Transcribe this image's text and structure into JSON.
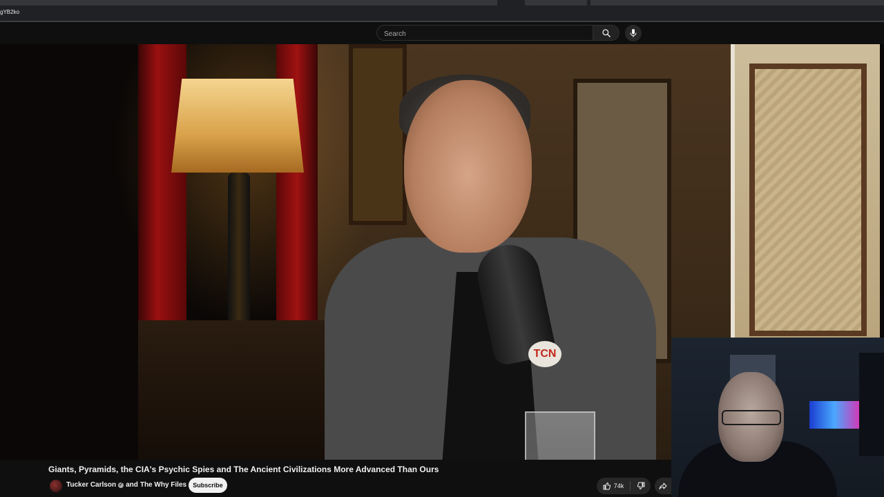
{
  "browser": {
    "url_fragment": "gYB2ko"
  },
  "header": {
    "search_placeholder": "Search",
    "icons": {
      "search": "search-icon",
      "mic": "microphone-icon"
    }
  },
  "video": {
    "mic_badge": "TCN"
  },
  "info": {
    "title": "Giants, Pyramids, the CIA's Psychic Spies and The Ancient Civilizations More Advanced Than Ours",
    "channel_1": "Tucker Carlson",
    "and_text": "and",
    "channel_2": "The Why Files",
    "verified_mark": "✓",
    "subscribe_label": "Subscribe",
    "like_count": "74k"
  },
  "colors": {
    "background": "#0f0f0f",
    "text": "#f1f1f1",
    "pill": "#272727",
    "subscribe_bg": "#f1f1f1"
  }
}
